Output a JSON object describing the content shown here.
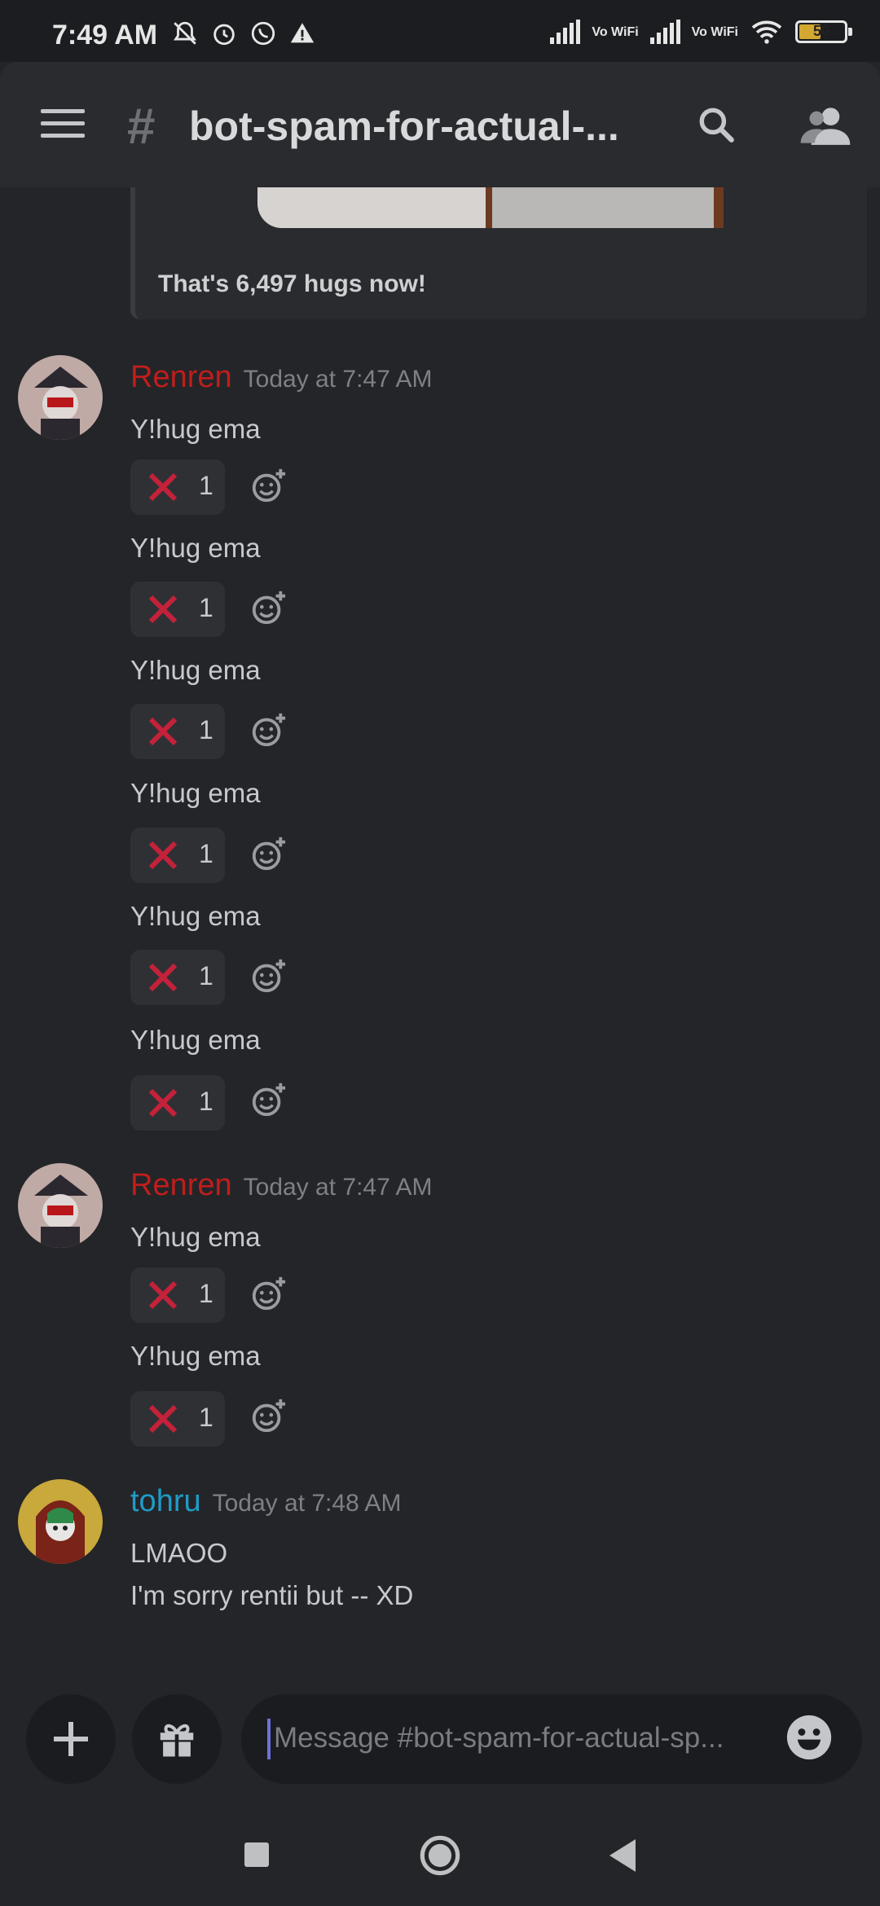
{
  "status_bar": {
    "time": "7:49 AM",
    "network_1": "Vo WiFi",
    "network_2": "Vo WiFi",
    "battery": "50"
  },
  "header": {
    "channel_hash": "#",
    "channel_name": "bot-spam-for-actual-..."
  },
  "embed": {
    "text": "That's 6,497 hugs now!"
  },
  "messages": [
    {
      "author": "Renren",
      "author_color": "#c01d1d",
      "timestamp": "Today at 7:47 AM",
      "lines": [
        "Y!hug ema",
        "Y!hug ema",
        "Y!hug ema",
        "Y!hug ema",
        "Y!hug ema",
        "Y!hug ema"
      ],
      "reaction": {
        "emoji": "x-cross-icon",
        "count": "1"
      }
    },
    {
      "author": "Renren",
      "author_color": "#c01d1d",
      "timestamp": "Today at 7:47 AM",
      "lines": [
        "Y!hug ema",
        "Y!hug ema"
      ],
      "reaction": {
        "emoji": "x-cross-icon",
        "count": "1"
      }
    },
    {
      "author": "tohru",
      "author_color": "#1f9bc6",
      "timestamp": "Today at 7:48 AM",
      "lines": [
        "LMAOO",
        "I'm sorry rentii but -- XD"
      ]
    }
  ],
  "input": {
    "placeholder": "Message #bot-spam-for-actual-sp..."
  },
  "colors": {
    "background": "#242528",
    "reaction_x": "#c4213a"
  }
}
